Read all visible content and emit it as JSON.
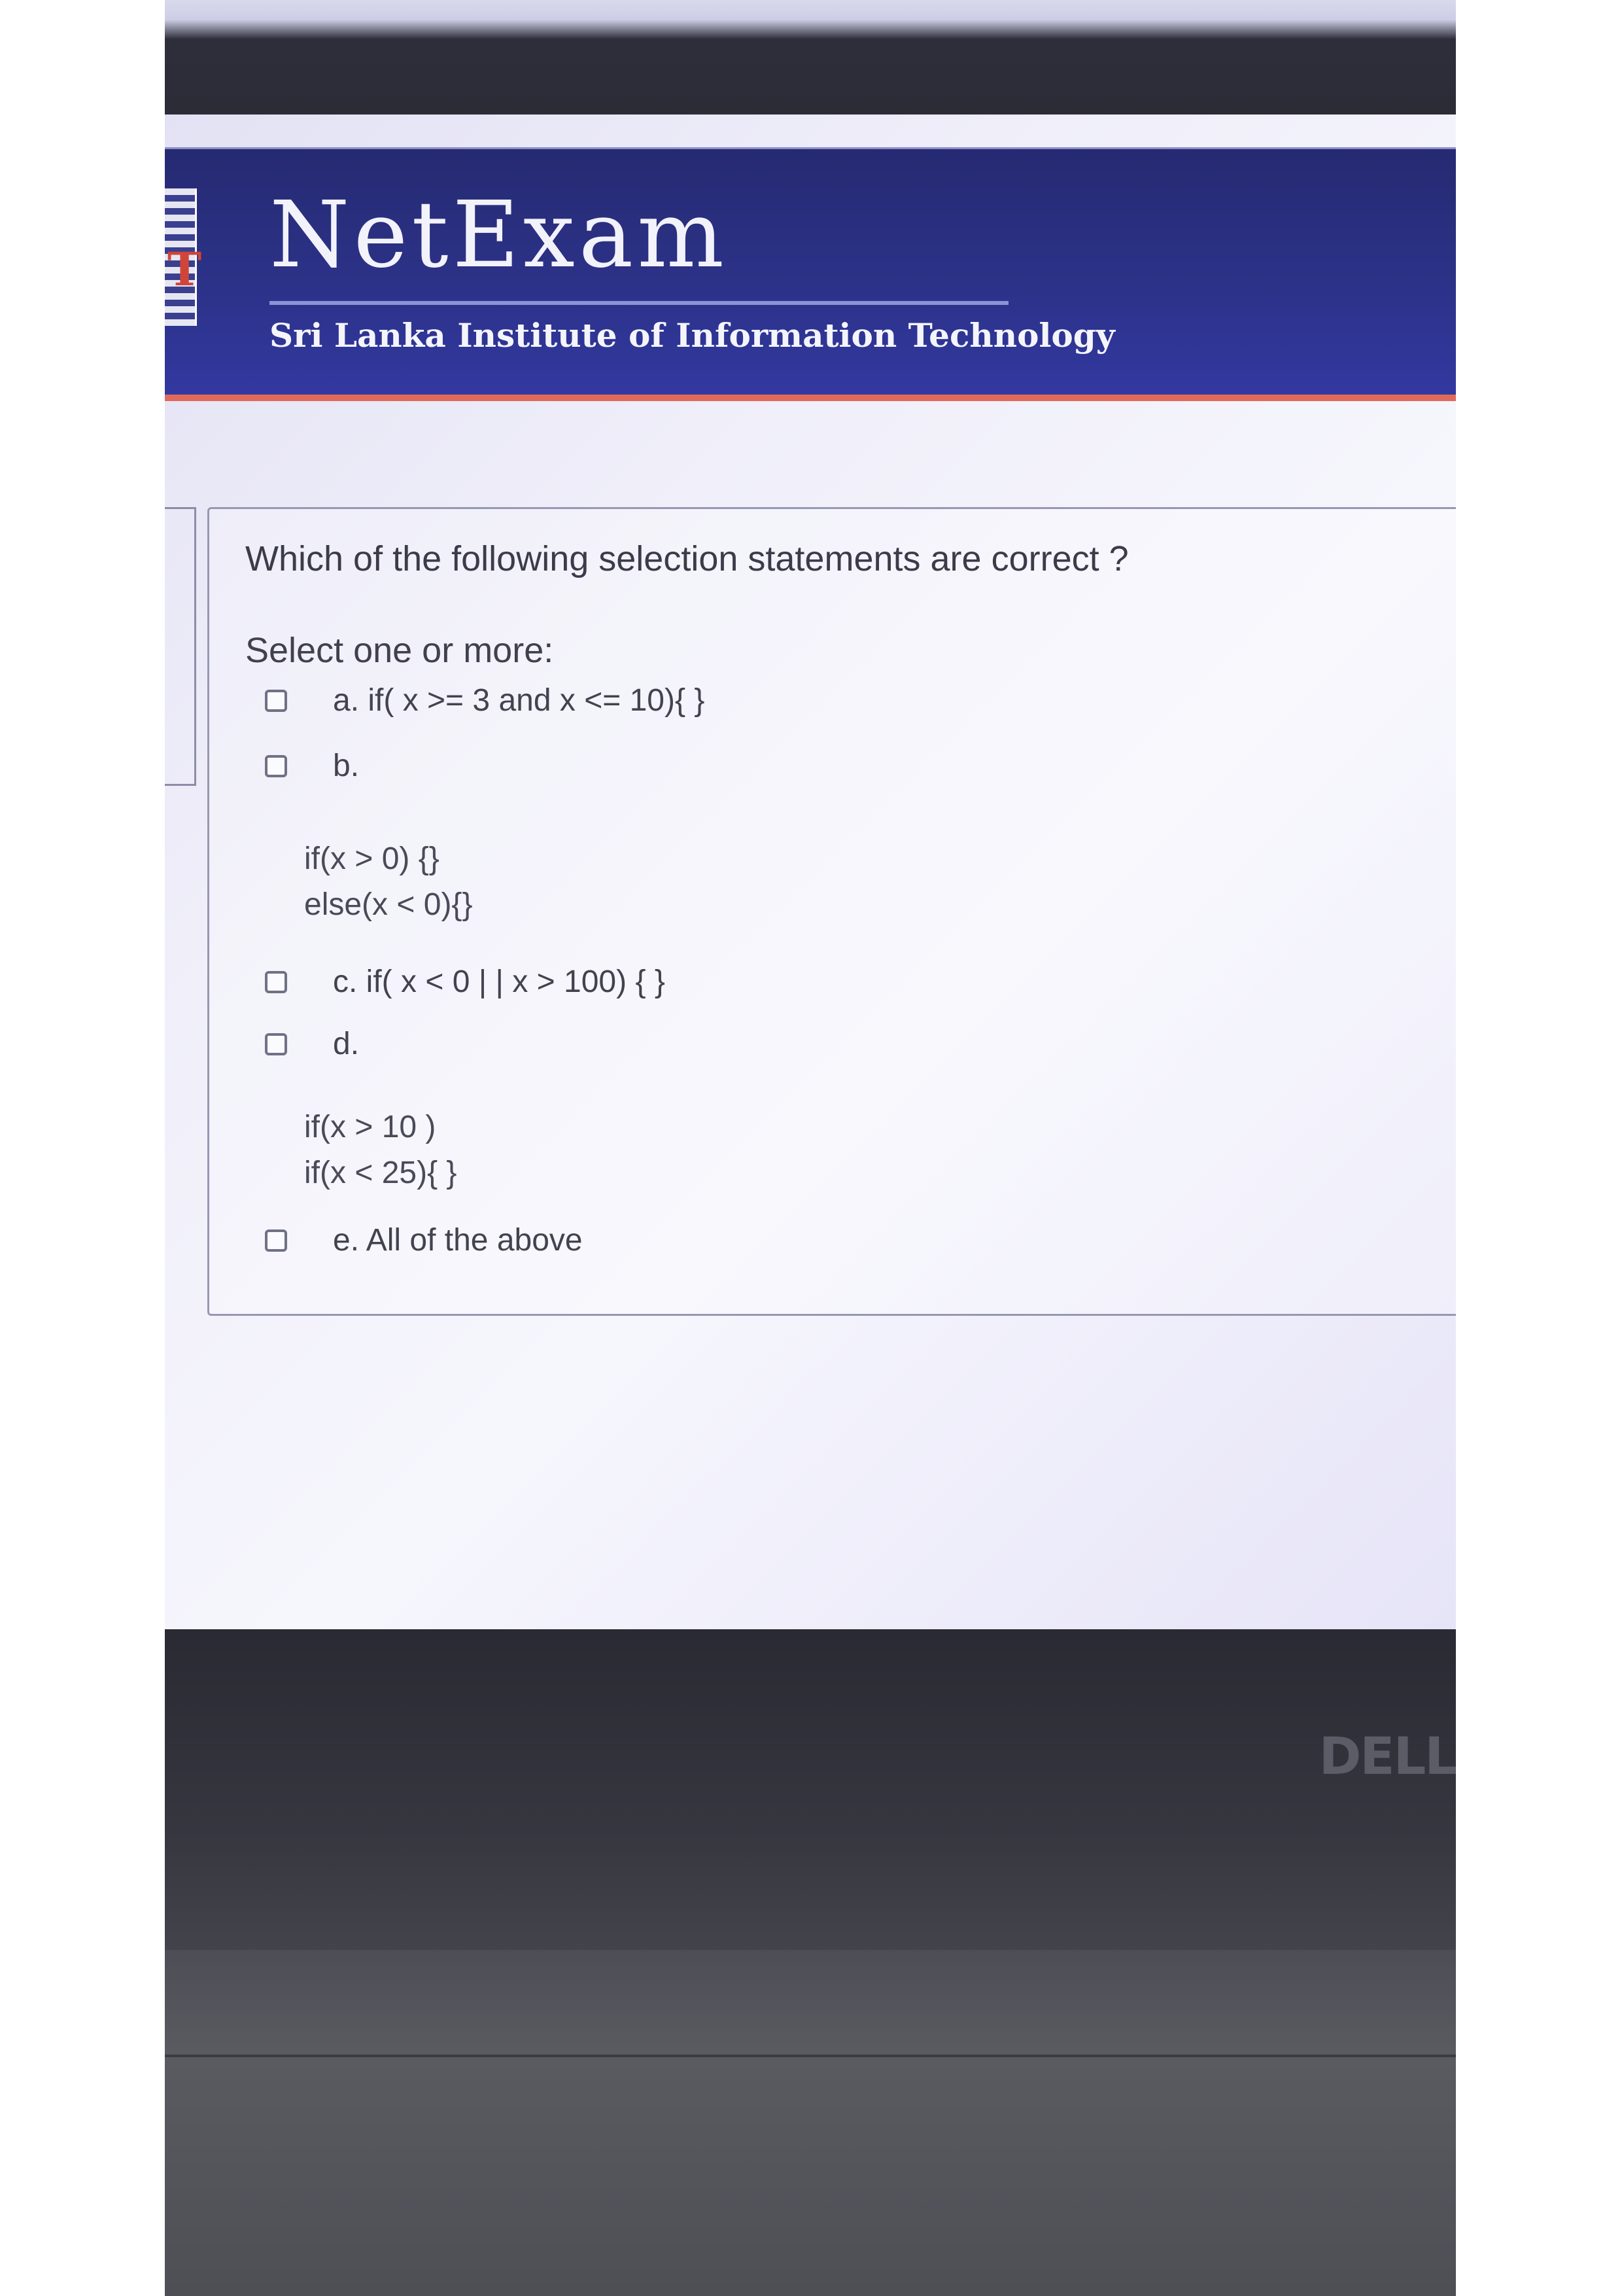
{
  "header": {
    "brand": "NetExam",
    "institute": "Sri Lanka Institute of Information Technology",
    "logo_letter": "T"
  },
  "question": {
    "text": "Which of the following selection statements are correct ?",
    "prompt": "Select one or more:",
    "options": [
      {
        "label": "a. if( x >= 3 and x <= 10){ }",
        "checked": false
      },
      {
        "label": "b.",
        "checked": false,
        "code": [
          "if(x > 0) {}",
          "else(x < 0){}"
        ]
      },
      {
        "label": "c. if( x < 0 | | x > 100) { }",
        "checked": false
      },
      {
        "label": "d.",
        "checked": false,
        "code": [
          "if(x > 10 )",
          "if(x < 25){ }"
        ]
      },
      {
        "label": "e. All of the above",
        "checked": false
      }
    ]
  },
  "device": {
    "brand": "DELL"
  }
}
